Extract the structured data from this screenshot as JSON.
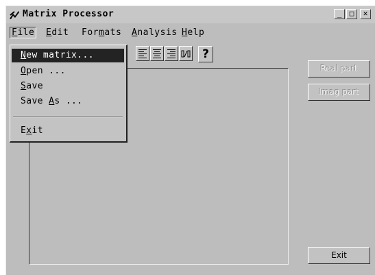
{
  "window": {
    "title": "Matrix Processor",
    "controls": {
      "minimize": "_",
      "maximize": "□",
      "close": "✕"
    }
  },
  "menubar": {
    "items": [
      {
        "label": "File",
        "accel": "F",
        "rest": "ile"
      },
      {
        "label": "Edit",
        "accel": "E",
        "rest": "dit"
      },
      {
        "label": "Formats",
        "pre": "For",
        "accel": "m",
        "rest": "ats"
      },
      {
        "label": "Analysis",
        "accel": "A",
        "rest": "nalysis"
      },
      {
        "label": "Help",
        "accel": "H",
        "rest": "elp"
      }
    ]
  },
  "file_menu": {
    "items": [
      {
        "label": "New matrix...",
        "pre": "",
        "accel": "N",
        "rest": "ew matrix..."
      },
      {
        "label": "Open ...",
        "pre": "",
        "accel": "O",
        "rest": "pen ..."
      },
      {
        "label": "Save",
        "pre": "",
        "accel": "S",
        "rest": "ave"
      },
      {
        "label": "Save As ...",
        "pre": "Save ",
        "accel": "A",
        "rest": "s ..."
      },
      {
        "label": "Exit",
        "pre": "E",
        "accel": "x",
        "rest": "it"
      }
    ],
    "selected_index": 0
  },
  "toolbar": {
    "icons": [
      "align-left-icon",
      "align-center-icon",
      "align-right-icon",
      "fraction-icon",
      "help-icon"
    ],
    "help_label": "?"
  },
  "side_buttons": {
    "real_part": "Real part",
    "imag_part": "Imag part",
    "exit": "Exit"
  }
}
